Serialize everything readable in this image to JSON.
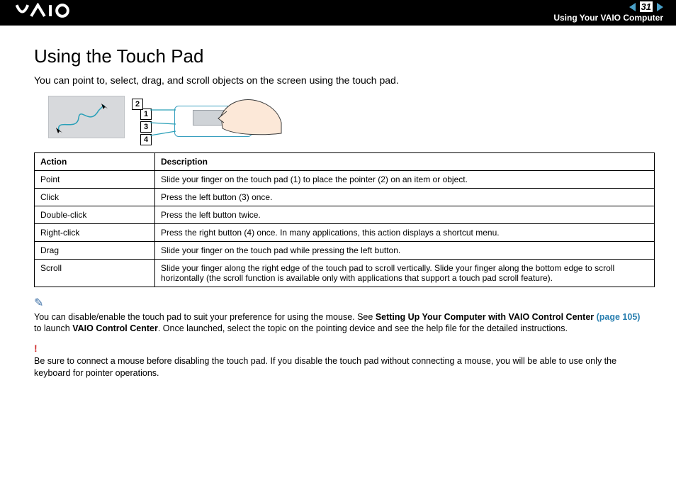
{
  "header": {
    "page_number": "31",
    "section": "Using Your VAIO Computer"
  },
  "title": "Using the Touch Pad",
  "intro": "You can point to, select, drag, and scroll objects on the screen using the touch pad.",
  "callouts": {
    "c1": "1",
    "c2": "2",
    "c3": "3",
    "c4": "4"
  },
  "table": {
    "head_action": "Action",
    "head_desc": "Description",
    "rows": [
      {
        "action": "Point",
        "desc": "Slide your finger on the touch pad (1) to place the pointer (2) on an item or object."
      },
      {
        "action": "Click",
        "desc": "Press the left button (3) once."
      },
      {
        "action": "Double-click",
        "desc": "Press the left button twice."
      },
      {
        "action": "Right-click",
        "desc": "Press the right button (4) once. In many applications, this action displays a shortcut menu."
      },
      {
        "action": "Drag",
        "desc": "Slide your finger on the touch pad while pressing the left button."
      },
      {
        "action": "Scroll",
        "desc": "Slide your finger along the right edge of the touch pad to scroll vertically. Slide your finger along the bottom edge to scroll horizontally (the scroll function is available only with applications that support a touch pad scroll feature)."
      }
    ]
  },
  "note": {
    "pre": "You can disable/enable the touch pad to suit your preference for using the mouse. See ",
    "bold1": "Setting Up Your Computer with VAIO Control Center ",
    "link": "(page 105)",
    "mid": " to launch ",
    "bold2": "VAIO Control Center",
    "post": ". Once launched, select the topic on the pointing device and see the help file for the detailed instructions."
  },
  "warning": "Be sure to connect a mouse before disabling the touch pad. If you disable the touch pad without connecting a mouse, you will be able to use only the keyboard for pointer operations."
}
